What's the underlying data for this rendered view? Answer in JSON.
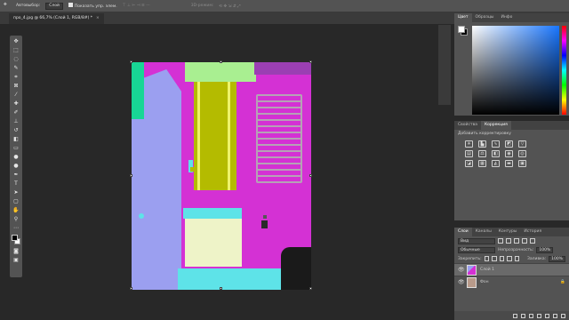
{
  "options_bar": {
    "autoselect_label": "Автовыбор:",
    "autoselect_value": "Слой",
    "transform_label": "Показать упр. элем.",
    "mode_label": "3D-режим:"
  },
  "document": {
    "tab_title": "про_4.jpg @ 66,7% (Слой 1, RGB/8#) *",
    "close_glyph": "×"
  },
  "color_panel": {
    "tabs": [
      "Цвет",
      "Образцы",
      "Инфо"
    ],
    "active_tab": 0,
    "hue_color": "#1976ff"
  },
  "adjustments_panel": {
    "tabs": [
      "Свойства",
      "Коррекция"
    ],
    "active_tab": 1,
    "hint": "Добавить корректировку"
  },
  "layers_panel": {
    "tabs": [
      "Слои",
      "Каналы",
      "Контуры",
      "История"
    ],
    "active_tab": 0,
    "kind_filter": "Вид",
    "blend_mode": "Обычные",
    "opacity_label": "Непрозрачность:",
    "opacity_value": "100%",
    "lock_label": "Закрепить:",
    "fill_label": "Заливка:",
    "fill_value": "100%",
    "layers": [
      {
        "name": "Слой 1",
        "selected": true
      },
      {
        "name": "Фон",
        "selected": false
      }
    ]
  },
  "canvas": {
    "colors": {
      "lavender": "#9b9ff0",
      "magenta": "#d431d4",
      "olive": "#b4bb00",
      "light_green": "#a9ef91",
      "teal": "#18d695",
      "cream": "#eef3c8",
      "cyan": "#5ee3e8",
      "dark": "#1a1a1a",
      "gray": "#b5a2b5"
    }
  }
}
